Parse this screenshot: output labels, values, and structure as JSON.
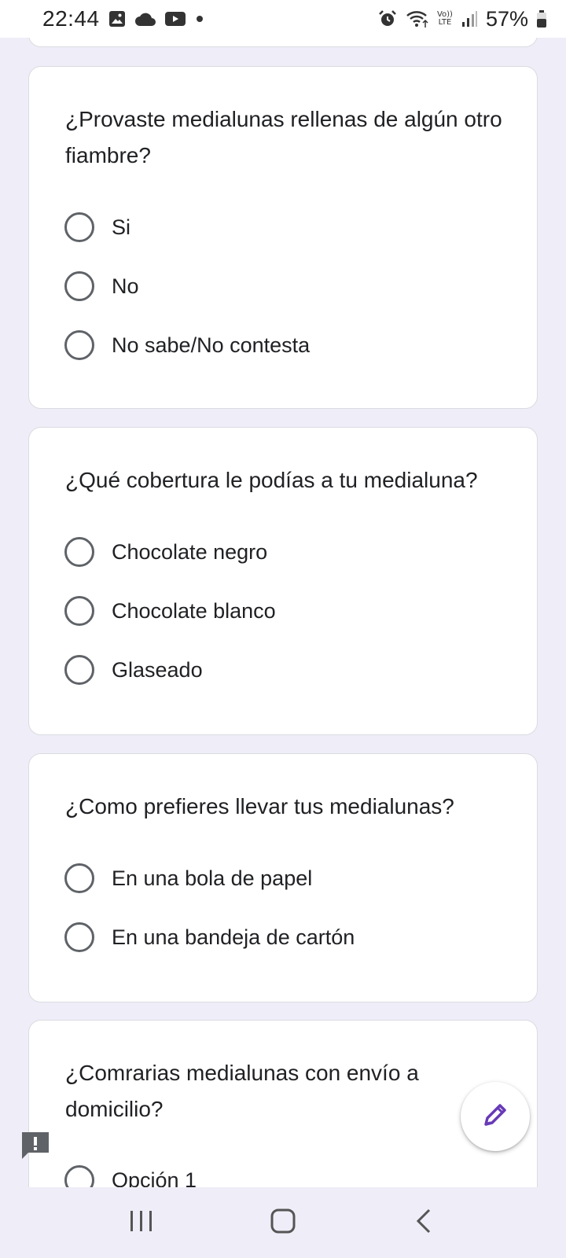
{
  "status_bar": {
    "time": "22:44",
    "battery_percent": "57%",
    "left_icons": [
      "image-icon",
      "cloud-icon",
      "youtube-icon",
      "dot-icon"
    ],
    "right_icons": [
      "alarm-icon",
      "wifi-icon",
      "volte-icon",
      "signal-icon",
      "battery-icon"
    ],
    "volte_label_top": "Vo))",
    "volte_label_bottom": "LTE"
  },
  "questions": [
    {
      "title": "¿Provaste medialunas rellenas de algún otro fiambre?",
      "options": [
        "Si",
        "No",
        "No sabe/No contesta"
      ]
    },
    {
      "title": "¿Qué cobertura le podías a tu medialuna?",
      "options": [
        "Chocolate negro",
        "Chocolate blanco",
        "Glaseado"
      ]
    },
    {
      "title": "¿Como prefieres llevar tus medialunas?",
      "options": [
        "En una bola de papel",
        "En una bandeja de cartón"
      ]
    },
    {
      "title": "¿Comrarias medialunas con envío a domicilio?",
      "options": [
        "Opción 1"
      ]
    }
  ],
  "fab": {
    "icon": "pencil-icon",
    "color": "#673ab7"
  },
  "feedback": {
    "icon": "feedback-icon"
  },
  "nav_bar": {
    "icons": [
      "recents-icon",
      "home-icon",
      "back-icon"
    ]
  },
  "colors": {
    "background": "#efedf8",
    "card": "#ffffff",
    "accent": "#673ab7"
  }
}
